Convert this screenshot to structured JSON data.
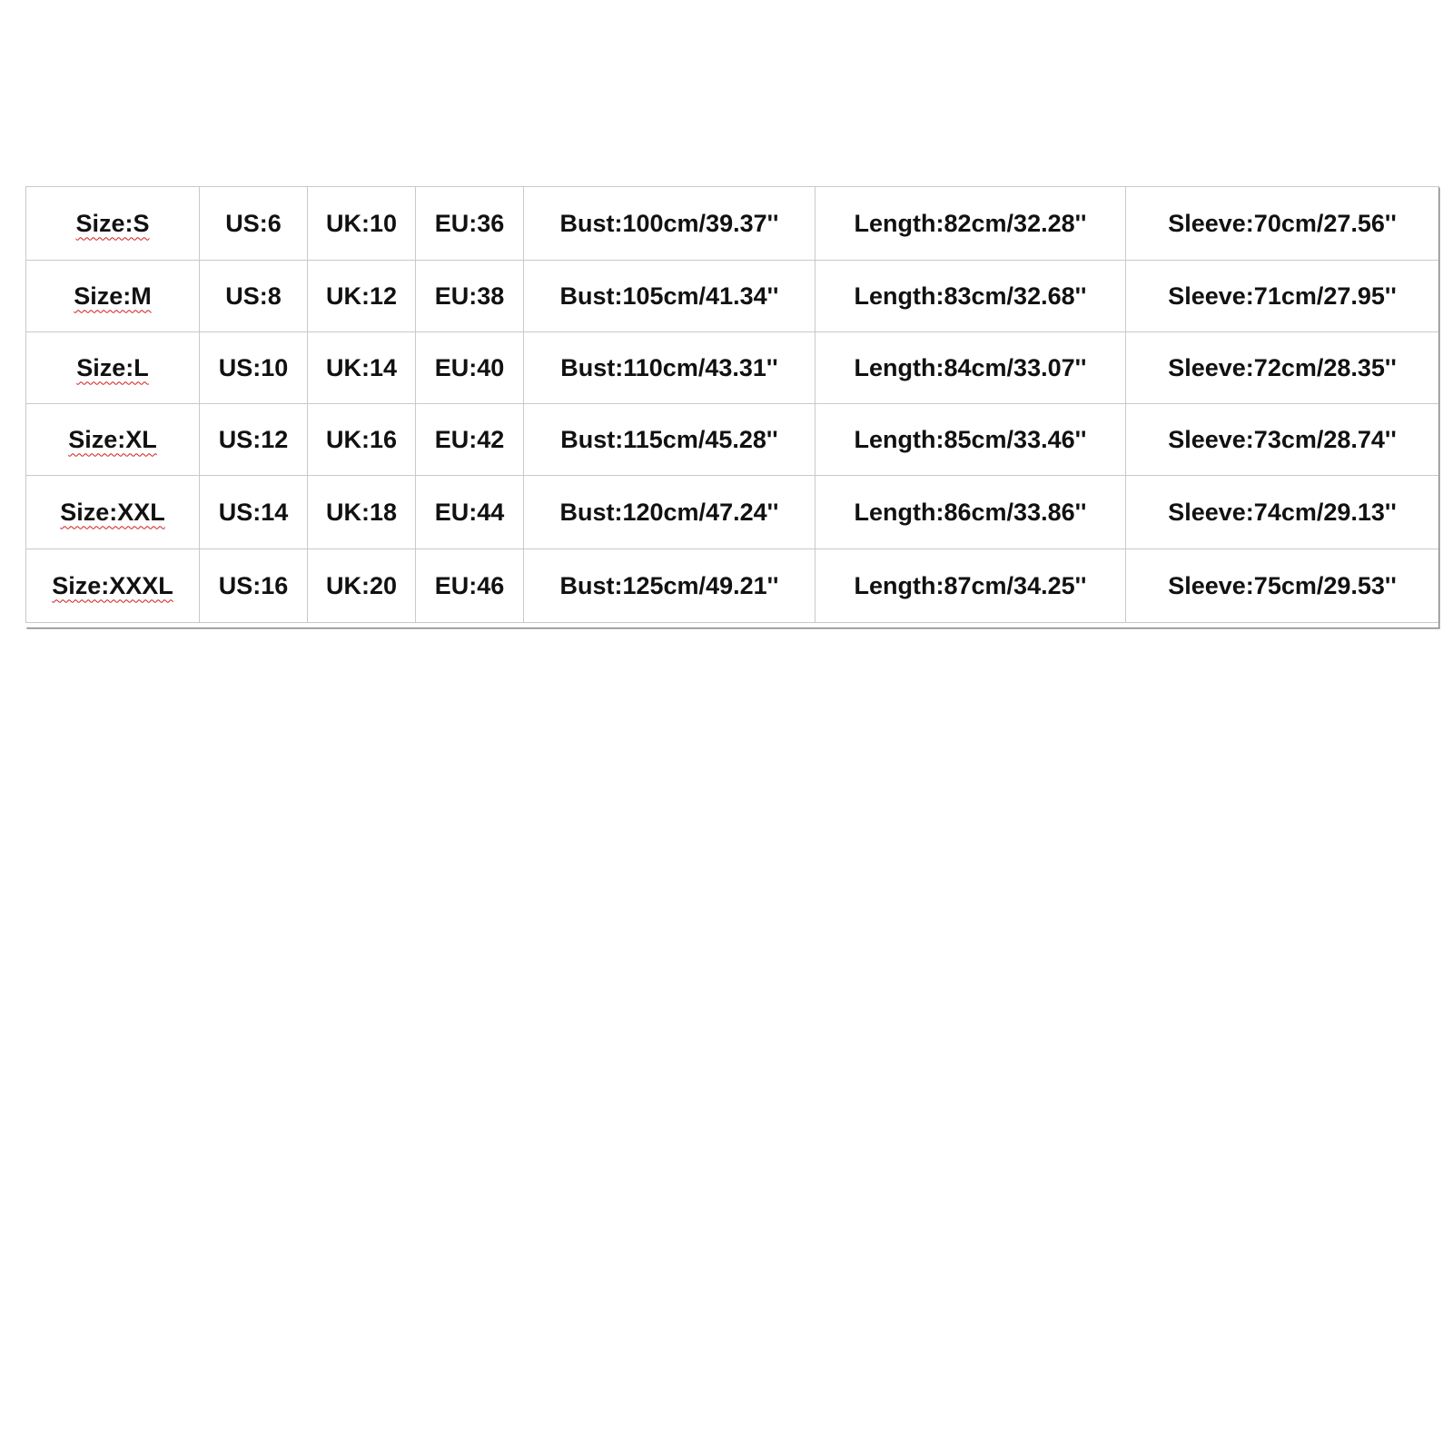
{
  "size_chart": {
    "rows": [
      {
        "size": "Size:S",
        "us": "US:6",
        "uk": "UK:10",
        "eu": "EU:36",
        "bust": "Bust:100cm/39.37''",
        "length": "Length:82cm/32.28''",
        "sleeve": "Sleeve:70cm/27.56''"
      },
      {
        "size": "Size:M",
        "us": "US:8",
        "uk": "UK:12",
        "eu": "EU:38",
        "bust": "Bust:105cm/41.34''",
        "length": "Length:83cm/32.68''",
        "sleeve": "Sleeve:71cm/27.95''"
      },
      {
        "size": "Size:L",
        "us": "US:10",
        "uk": "UK:14",
        "eu": "EU:40",
        "bust": "Bust:110cm/43.31''",
        "length": "Length:84cm/33.07''",
        "sleeve": "Sleeve:72cm/28.35''"
      },
      {
        "size": "Size:XL",
        "us": "US:12",
        "uk": "UK:16",
        "eu": "EU:42",
        "bust": "Bust:115cm/45.28''",
        "length": "Length:85cm/33.46''",
        "sleeve": "Sleeve:73cm/28.74''"
      },
      {
        "size": "Size:XXL",
        "us": "US:14",
        "uk": "UK:18",
        "eu": "EU:44",
        "bust": "Bust:120cm/47.24''",
        "length": "Length:86cm/33.86''",
        "sleeve": "Sleeve:74cm/29.13''"
      },
      {
        "size": "Size:XXXL",
        "us": "US:16",
        "uk": "UK:20",
        "eu": "EU:46",
        "bust": "Bust:125cm/49.21''",
        "length": "Length:87cm/34.25''",
        "sleeve": "Sleeve:75cm/29.53''"
      }
    ]
  },
  "colors": {
    "background": "#ffffff",
    "grid_line": "#c9c9c9",
    "text": "#111111",
    "spellcheck_underline": "#d11a1a"
  }
}
